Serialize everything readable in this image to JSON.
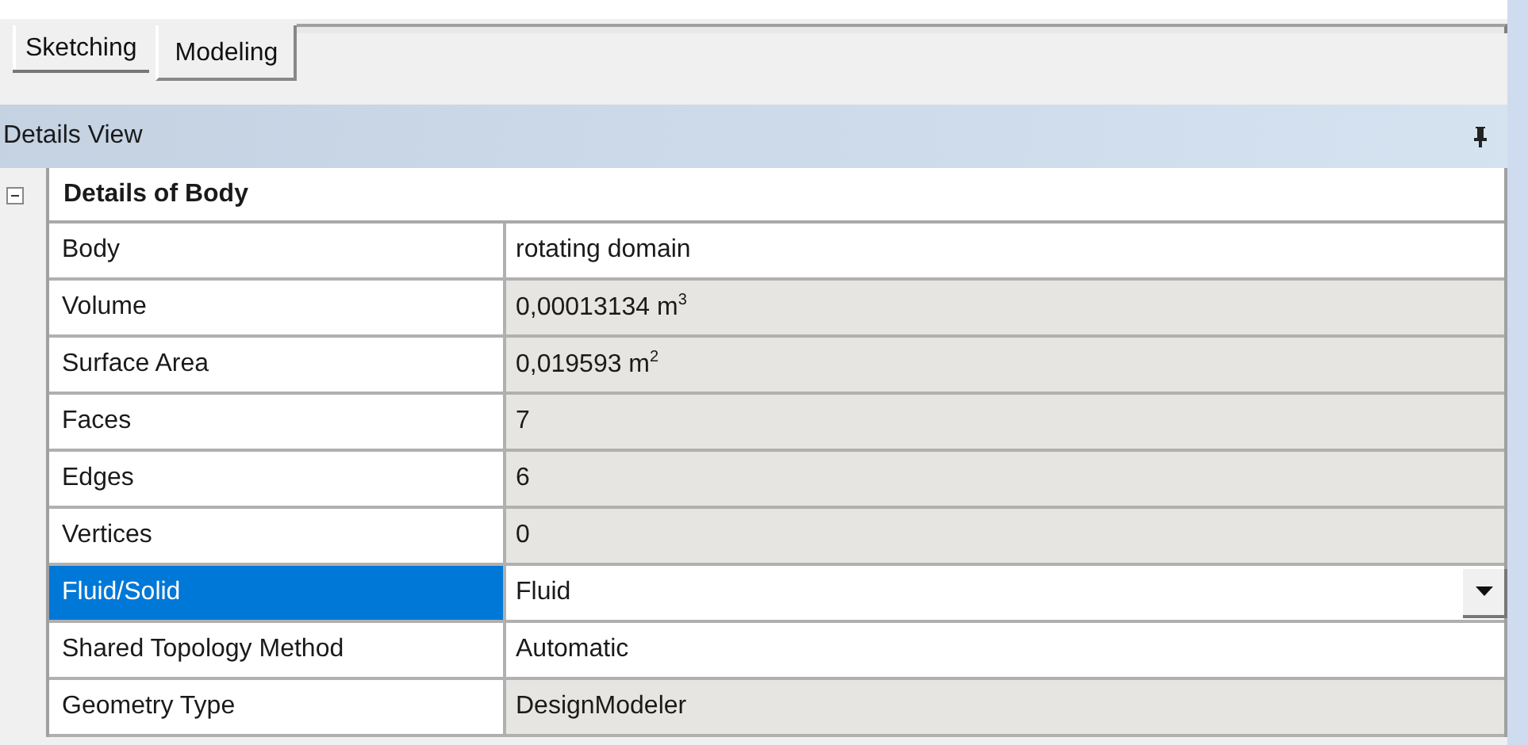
{
  "tabs": [
    {
      "label": "Sketching",
      "selected": false
    },
    {
      "label": "Modeling",
      "selected": true
    }
  ],
  "details_view": {
    "title": "Details View",
    "group": {
      "title": "Details of Body",
      "expanded": true
    },
    "rows": [
      {
        "label": "Body",
        "value": "rotating domain",
        "kind": "text",
        "readonly": false,
        "selected": false
      },
      {
        "label": "Volume",
        "value": "0,00013134 m$^{3}$",
        "kind": "text",
        "readonly": true,
        "selected": false
      },
      {
        "label": "Surface Area",
        "value": "0,019593 m$^{2}$",
        "kind": "text",
        "readonly": true,
        "selected": false
      },
      {
        "label": "Faces",
        "value": "7",
        "kind": "text",
        "readonly": true,
        "selected": false
      },
      {
        "label": "Edges",
        "value": "6",
        "kind": "text",
        "readonly": true,
        "selected": false
      },
      {
        "label": "Vertices",
        "value": "0",
        "kind": "text",
        "readonly": true,
        "selected": false
      },
      {
        "label": "Fluid/Solid",
        "value": "Fluid",
        "kind": "dropdown",
        "readonly": false,
        "selected": true
      },
      {
        "label": "Shared Topology Method",
        "value": "Automatic",
        "kind": "text",
        "readonly": false,
        "selected": false
      },
      {
        "label": "Geometry Type",
        "value": "DesignModeler",
        "kind": "text",
        "readonly": true,
        "selected": false
      }
    ]
  }
}
